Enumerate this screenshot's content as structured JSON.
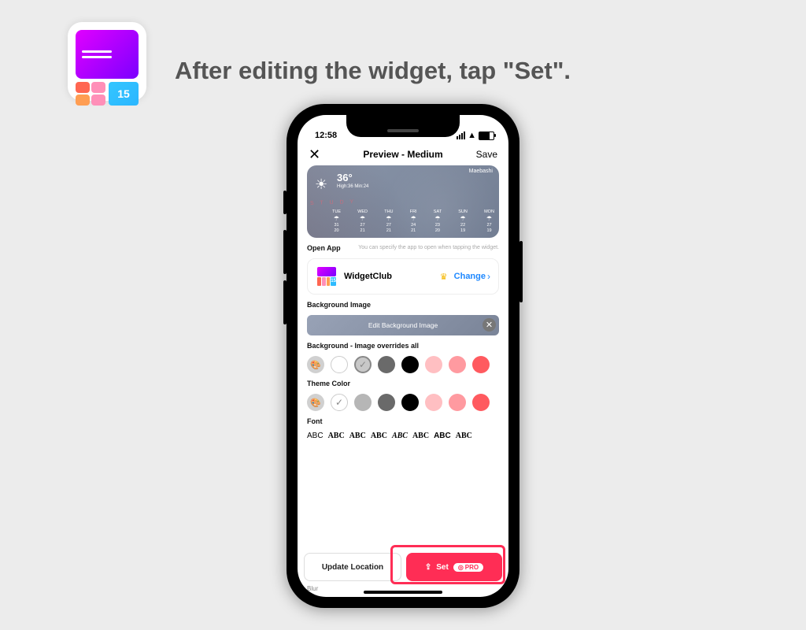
{
  "logo_number": "15",
  "headline": "After editing the widget, tap \"Set\".",
  "status": {
    "time": "12:58"
  },
  "header": {
    "close": "✕",
    "title": "Preview - Medium",
    "save": "Save"
  },
  "preview": {
    "location": "Maebashi",
    "temp": "36°",
    "high": "High:36",
    "low": "Min:24",
    "overlay": "S T U D Y",
    "days": [
      {
        "d": "TUE",
        "t1": "31",
        "t2": "20"
      },
      {
        "d": "WED",
        "t1": "27",
        "t2": "21"
      },
      {
        "d": "THU",
        "t1": "27",
        "t2": "21"
      },
      {
        "d": "FRI",
        "t1": "24",
        "t2": "21"
      },
      {
        "d": "SAT",
        "t1": "23",
        "t2": "20"
      },
      {
        "d": "SUN",
        "t1": "22",
        "t2": "19"
      },
      {
        "d": "MON",
        "t1": "27",
        "t2": "19"
      }
    ]
  },
  "open_app": {
    "label": "Open App",
    "hint": "You can specify the app to open when tapping the widget.",
    "app_name": "WidgetClub",
    "change": "Change"
  },
  "bg_image": {
    "label": "Background Image",
    "button": "Edit Background Image"
  },
  "bg_color": {
    "label": "Background - Image overrides all",
    "swatches": [
      "palette",
      "#ffffff",
      "#c8c8c8",
      "#6a6a6a",
      "#000000",
      "#ffbfc2",
      "#ff9aa0",
      "#ff5a5f"
    ],
    "selected": 2
  },
  "theme_color": {
    "label": "Theme Color",
    "swatches": [
      "palette",
      "#ffffff",
      "#b6b6b6",
      "#6a6a6a",
      "#000000",
      "#ffbfc2",
      "#ff9aa0",
      "#ff5a5f"
    ],
    "selected": 1
  },
  "font": {
    "label": "Font",
    "sample": "ABC",
    "count": 8
  },
  "footer": {
    "update": "Update Location",
    "set": "Set",
    "pro": "PRO"
  },
  "blur_label": "Blur"
}
